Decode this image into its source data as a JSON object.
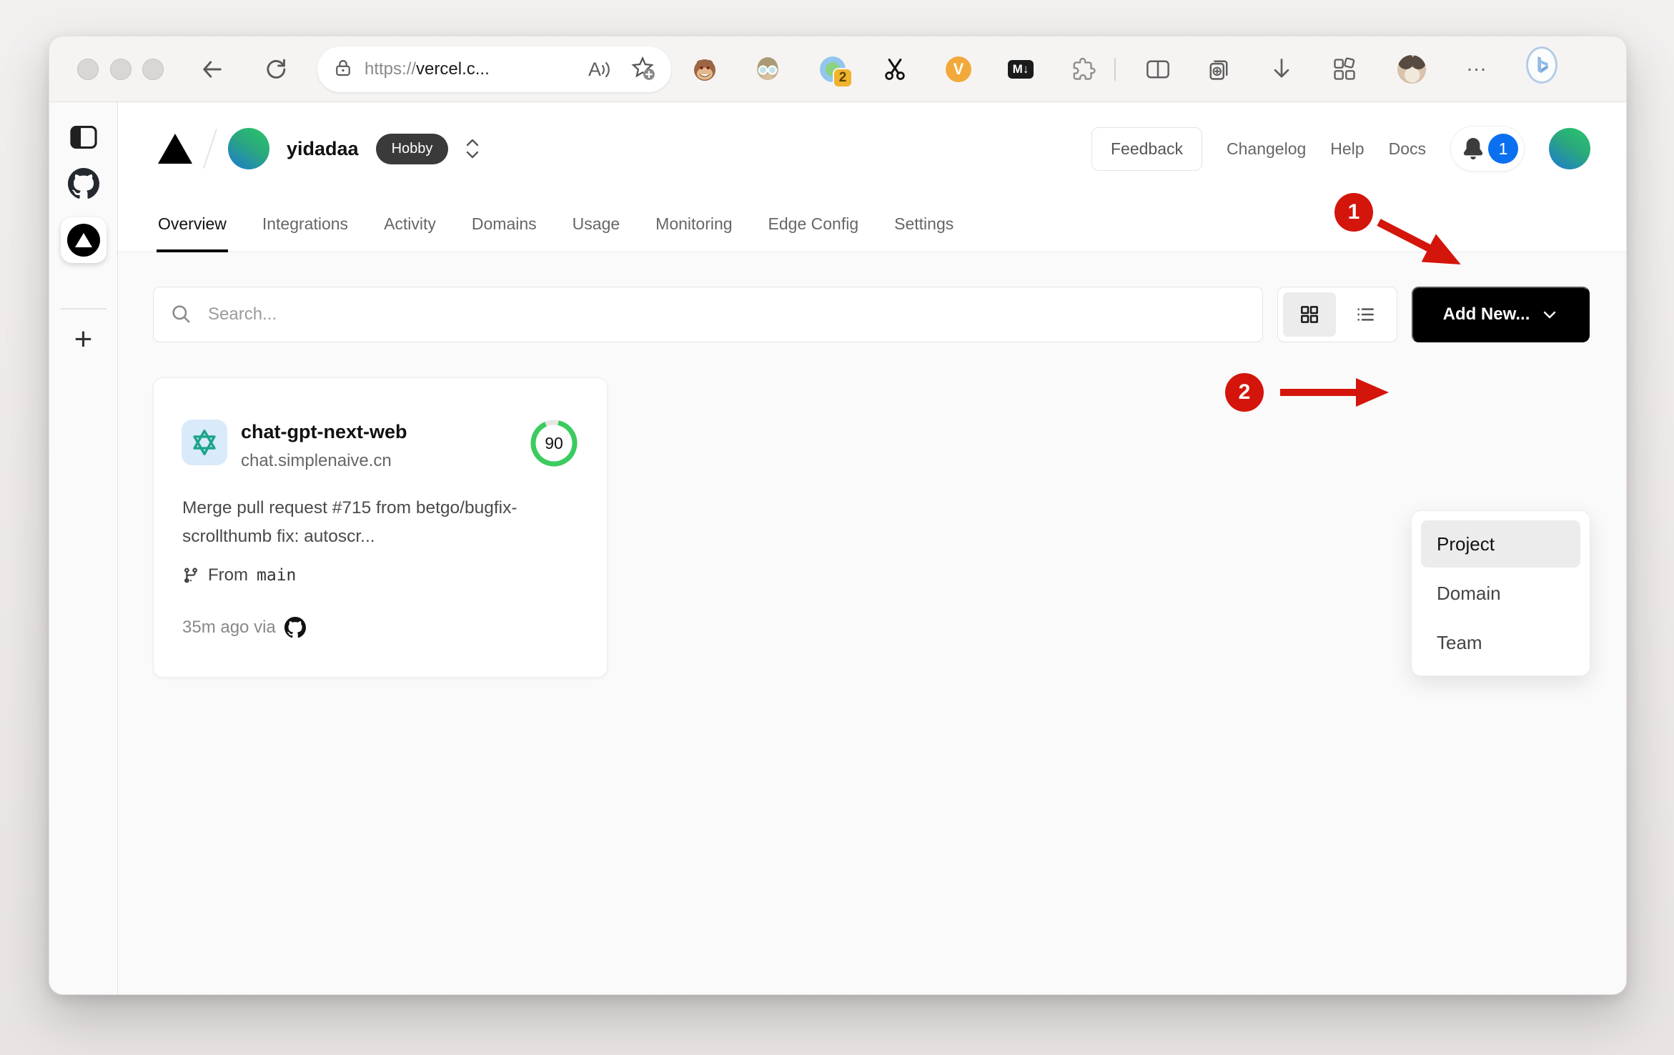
{
  "browser": {
    "url_scheme": "https://",
    "url_host": "vercel.c...",
    "extensions_badge_count": "2",
    "v_ext_label": "V",
    "markdown_ext_label": "M↓",
    "more_label": "…"
  },
  "vercel_header": {
    "team_name": "yidadaa",
    "plan_badge": "Hobby",
    "feedback_label": "Feedback",
    "links": [
      {
        "label": "Changelog"
      },
      {
        "label": "Help"
      },
      {
        "label": "Docs"
      }
    ],
    "notification_count": "1"
  },
  "tabs": [
    {
      "label": "Overview",
      "active": true
    },
    {
      "label": "Integrations"
    },
    {
      "label": "Activity"
    },
    {
      "label": "Domains"
    },
    {
      "label": "Usage"
    },
    {
      "label": "Monitoring"
    },
    {
      "label": "Edge Config"
    },
    {
      "label": "Settings"
    }
  ],
  "controls": {
    "search_placeholder": "Search...",
    "add_new_label": "Add New..."
  },
  "add_new_menu": {
    "items": [
      {
        "label": "Project",
        "highlighted": true
      },
      {
        "label": "Domain"
      },
      {
        "label": "Team"
      }
    ]
  },
  "project_card": {
    "name": "chat-gpt-next-web",
    "domain": "chat.simplenaive.cn",
    "score": "90",
    "commit_message": "Merge pull request #715 from betgo/bugfix-scrollthumb fix: autoscr...",
    "branch_prefix": "From",
    "branch_name": "main",
    "deploy_meta": "35m ago via"
  },
  "annotations": {
    "step_1": "1",
    "step_2": "2"
  },
  "colors": {
    "accent_red": "#d4150b",
    "score_green": "#3bcb5f",
    "notification_blue": "#0b70f0",
    "add_new_bg": "#000000",
    "openai_teal": "#1ca58b"
  }
}
